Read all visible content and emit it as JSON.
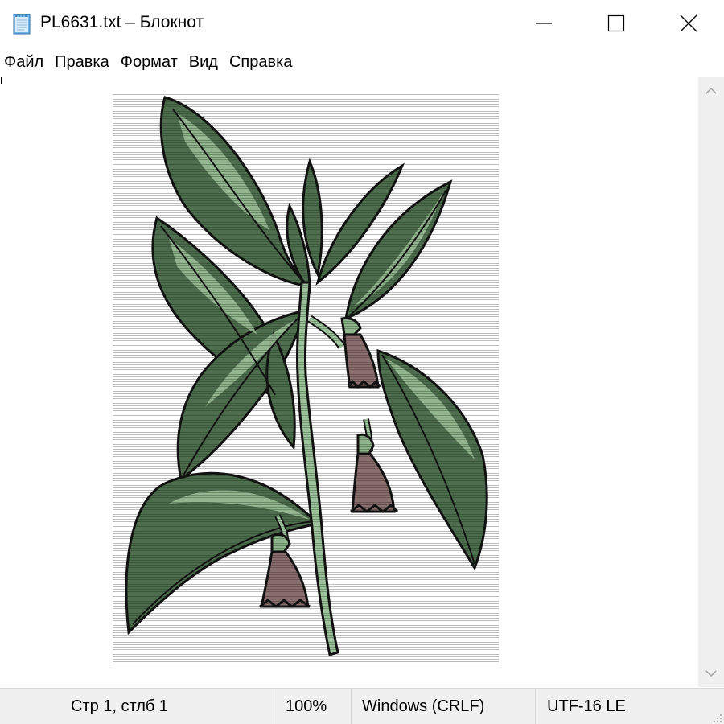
{
  "window": {
    "title": "PL6631.txt – Блокнот",
    "icon": "notepad-icon",
    "controls": {
      "minimize_icon": "minimize-icon",
      "maximize_icon": "maximize-icon",
      "close_icon": "close-icon"
    }
  },
  "menu": {
    "items": [
      "Файл",
      "Правка",
      "Формат",
      "Вид",
      "Справка"
    ]
  },
  "editor": {
    "content": "ASCII-art illustration of a flowering plant with green leaves and three pink-brown bell-shaped flowers",
    "colors": {
      "leaf_dark": "#3e5a3e",
      "leaf_light": "#8db58a",
      "stem": "#9cc49a",
      "flower": "#8a6e6e",
      "outline": "#1a1a1a"
    }
  },
  "scrollbar": {
    "up_icon": "scroll-up-arrow-icon",
    "down_icon": "scroll-down-arrow-icon"
  },
  "statusbar": {
    "position": "Стр 1, стлб 1",
    "zoom": "100%",
    "line_ending": "Windows (CRLF)",
    "encoding": "UTF-16 LE"
  }
}
